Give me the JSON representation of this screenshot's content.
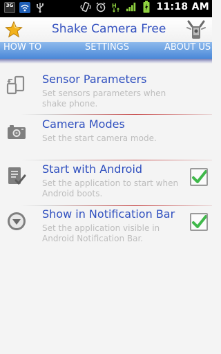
{
  "status_bar": {
    "network_badge": "3G",
    "time": "11:18 AM",
    "icons": [
      "3g-icon",
      "wifi-icon",
      "usb-icon",
      "vibrate-icon",
      "alarm-icon",
      "data-icon",
      "signal-icon",
      "battery-charging-icon"
    ]
  },
  "titlebar": {
    "title": "Shake Camera Free",
    "left_icon": "star-icon",
    "right_icon": "shake-icon"
  },
  "tabs": [
    {
      "label": "HOW TO",
      "selected": false
    },
    {
      "label": "SETTINGS",
      "selected": true
    },
    {
      "label": "ABOUT US",
      "selected": false
    }
  ],
  "settings": [
    {
      "title": "Sensor Parameters",
      "summary": "Set sensors parameters when shake phone.",
      "icon": "sensor-icon"
    },
    {
      "title": "Camera Modes",
      "summary": "Set the start camera mode.",
      "icon": "camera-icon"
    },
    {
      "title": "Start with Android",
      "summary": "Set the application to start when Android boots.",
      "icon": "checklist-icon",
      "checked": true
    },
    {
      "title": "Show in Notification Bar",
      "summary": "Set the application visible in Android Notification Bar.",
      "icon": "notification-icon",
      "checked": true
    }
  ],
  "colors": {
    "title": "#3552c0",
    "tab_bar": "#4a88d8",
    "item_title": "#2f4fbf",
    "summary": "#bdbdbd",
    "check": "#3fb84a"
  }
}
